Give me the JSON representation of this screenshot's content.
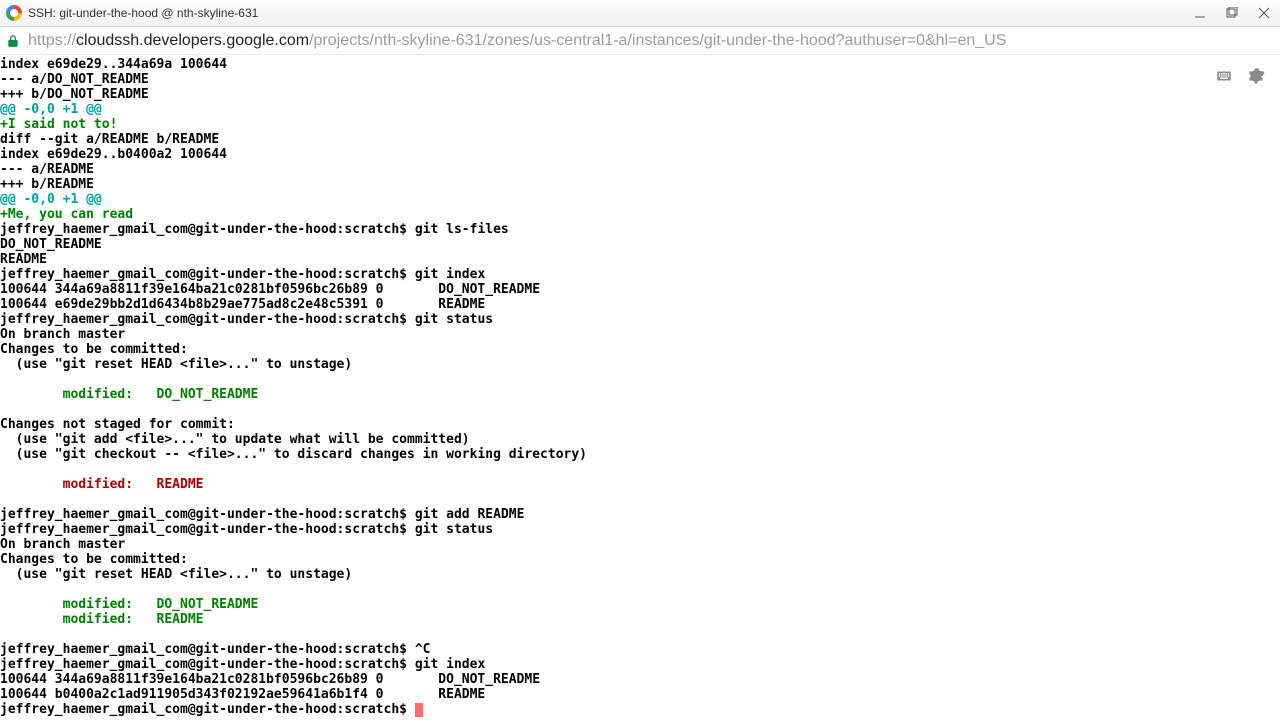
{
  "window": {
    "title": "SSH: git-under-the-hood @ nth-skyline-631"
  },
  "url": {
    "scheme": "https://",
    "host": "cloudssh.developers.google.com",
    "path": "/projects/nth-skyline-631/zones/us-central1-a/instances/git-under-the-hood?authuser=0&hl=en_US"
  },
  "prompt": "jeffrey_haemer_gmail_com@git-under-the-hood:scratch$ ",
  "term": {
    "l01": "index e69de29..344a69a 100644",
    "l02": "--- a/DO_NOT_README",
    "l03": "+++ b/DO_NOT_README",
    "l04": "@@ -0,0 +1 @@",
    "l05": "+I said not to!",
    "l06": "diff --git a/README b/README",
    "l07": "index e69de29..b0400a2 100644",
    "l08": "--- a/README",
    "l09": "+++ b/README",
    "l10": "@@ -0,0 +1 @@",
    "l11": "+Me, you can read",
    "cmd_lsfiles": "git ls-files",
    "l12": "DO_NOT_README",
    "l13": "README",
    "cmd_index1": "git index",
    "l14": "100644 344a69a8811f39e164ba21c0281bf0596bc26b89 0       DO_NOT_README",
    "l15": "100644 e69de29bb2d1d6434b8b29ae775ad8c2e48c5391 0       README",
    "cmd_status1": "git status",
    "l16": "On branch master",
    "l17": "Changes to be committed:",
    "l18": "  (use \"git reset HEAD <file>...\" to unstage)",
    "l19": "        modified:   DO_NOT_README",
    "l20": "Changes not staged for commit:",
    "l21": "  (use \"git add <file>...\" to update what will be committed)",
    "l22": "  (use \"git checkout -- <file>...\" to discard changes in working directory)",
    "l23": "        modified:   README",
    "cmd_add": "git add README",
    "cmd_status2": "git status",
    "l24": "On branch master",
    "l25": "Changes to be committed:",
    "l26": "  (use \"git reset HEAD <file>...\" to unstage)",
    "l27": "        modified:   DO_NOT_README",
    "l28": "        modified:   README",
    "cmd_ctrlc": "^C",
    "cmd_index2": "git index",
    "l29": "100644 344a69a8811f39e164ba21c0281bf0596bc26b89 0       DO_NOT_README",
    "l30": "100644 b0400a2c1ad911905d343f02192ae59641a6b1f4 0       README"
  }
}
